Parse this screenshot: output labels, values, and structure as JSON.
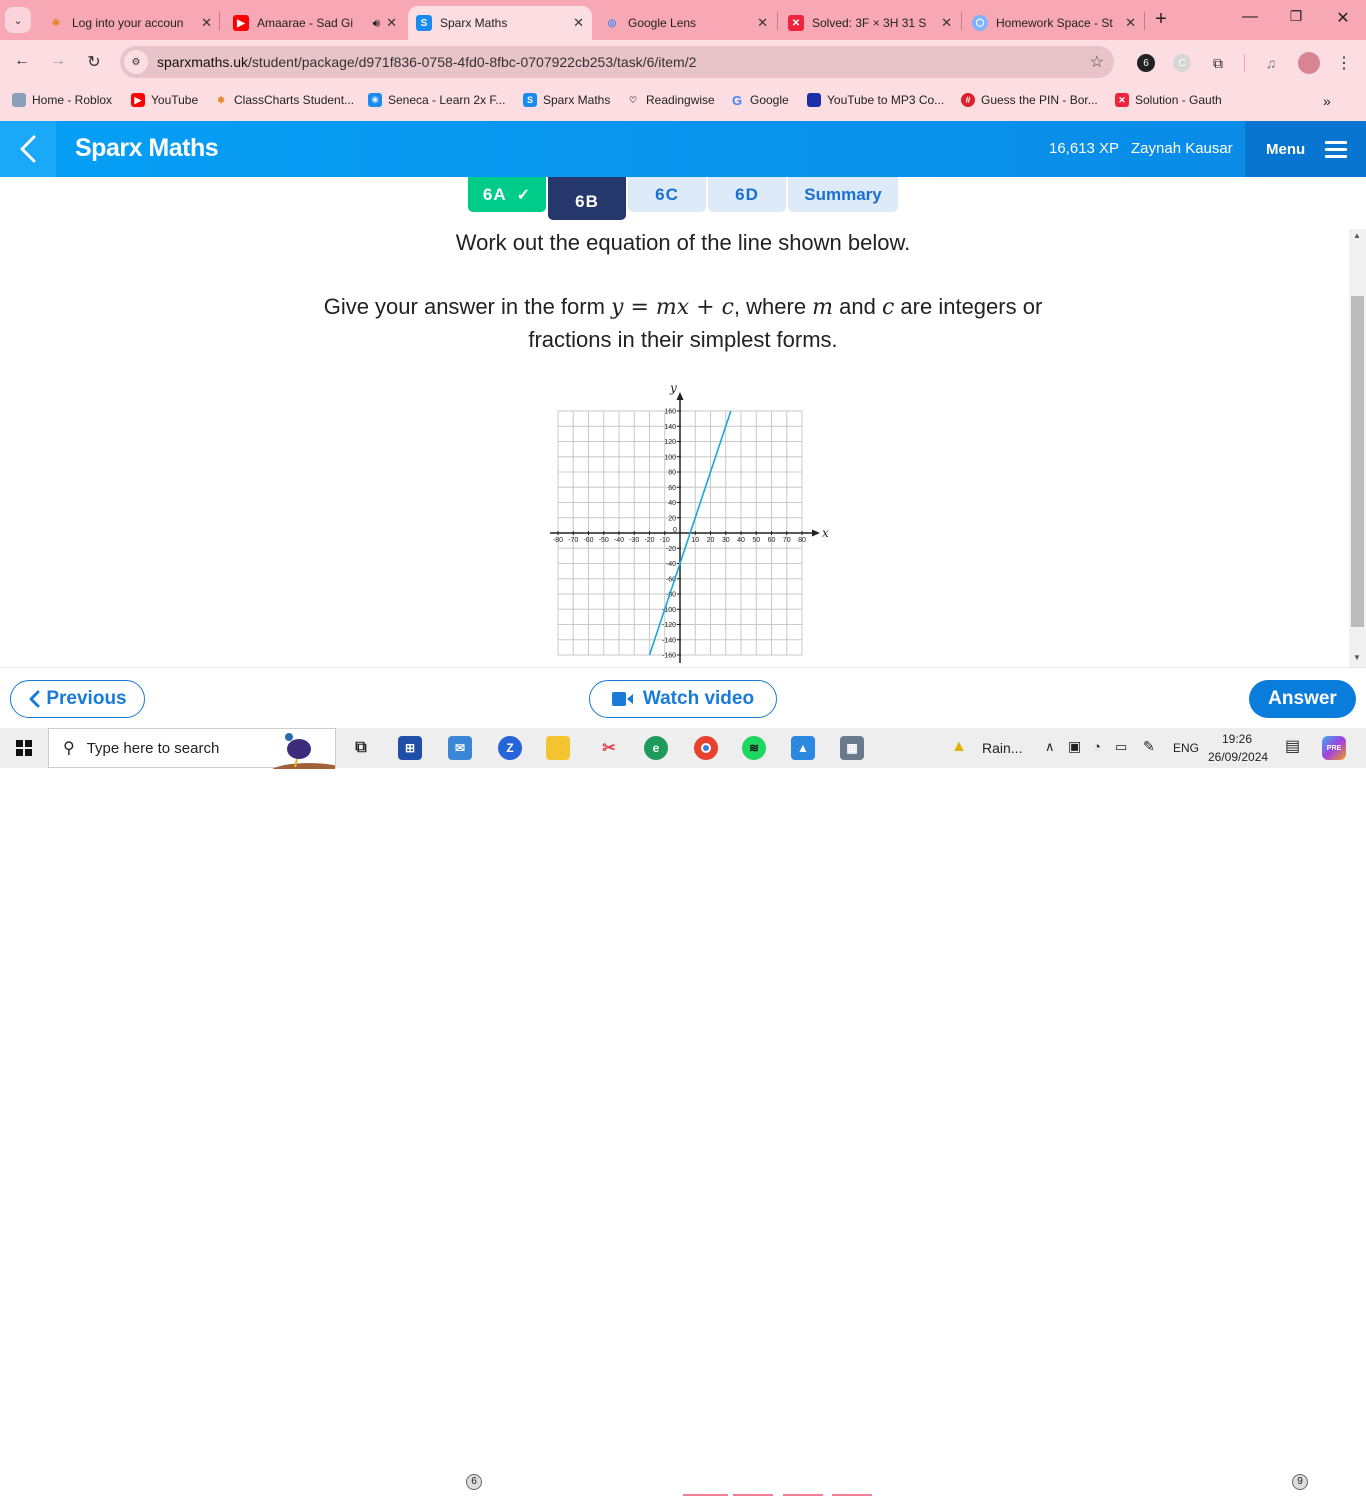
{
  "browser": {
    "tabs": [
      {
        "title": "Log into your accoun",
        "favicon": "classcharts-icon",
        "active": false,
        "audio": false
      },
      {
        "title": "Amaarae - Sad Gi",
        "favicon": "youtube-icon",
        "active": false,
        "audio": true
      },
      {
        "title": "Sparx Maths",
        "favicon": "sparx-icon",
        "active": true,
        "audio": false
      },
      {
        "title": "Google Lens",
        "favicon": "google-lens-icon",
        "active": false,
        "audio": false
      },
      {
        "title": "Solved: 3F × 3H 31 S",
        "favicon": "gauth-icon",
        "active": false,
        "audio": false
      },
      {
        "title": "Homework Space - St",
        "favicon": "homework-space-icon",
        "active": false,
        "audio": false
      }
    ],
    "new_tab": "+",
    "url_domain": "sparxmaths.uk",
    "url_path": "/student/package/d971f836-0758-4fd0-8fbc-0707922cb253/task/6/item/2",
    "bookmarks": [
      {
        "label": "Home - Roblox",
        "icon": "roblox-icon",
        "color": "#8aa0b8"
      },
      {
        "label": "YouTube",
        "icon": "youtube-icon",
        "color": "#ff0000"
      },
      {
        "label": "ClassCharts Student...",
        "icon": "classcharts-icon",
        "color": "#e58a2b"
      },
      {
        "label": "Seneca - Learn 2x F...",
        "icon": "seneca-icon",
        "color": "#1a8cf0"
      },
      {
        "label": "Sparx Maths",
        "icon": "sparx-icon",
        "color": "#1a8cf0"
      },
      {
        "label": "Readingwise",
        "icon": "readingwise-icon",
        "color": "#555555"
      },
      {
        "label": "Google",
        "icon": "google-icon",
        "color": "#4285f4"
      },
      {
        "label": "YouTube to MP3 Co...",
        "icon": "mp3-converter-icon",
        "color": "#1b2fa8"
      },
      {
        "label": "Guess the PIN - Bor...",
        "icon": "pin-game-icon",
        "color": "#e0202a"
      },
      {
        "label": "Solution - Gauth",
        "icon": "gauth-icon",
        "color": "#f0233c"
      }
    ],
    "more_bookmarks": "»"
  },
  "app": {
    "title": "Sparx Maths",
    "xp": "16,613 XP",
    "user": "Zaynah Kausar",
    "menu_label": "Menu",
    "brand_color": "#0a8ae6"
  },
  "task_tabs": [
    {
      "label": "6A",
      "state": "complete",
      "check": "✓",
      "bg": "#00cc8a",
      "fg": "#ffffff"
    },
    {
      "label": "6B",
      "state": "current",
      "bg": "#26386b",
      "fg": "#ffffff"
    },
    {
      "label": "6C",
      "state": "pending",
      "bg": "#ddeaf7",
      "fg": "#1a6fd0"
    },
    {
      "label": "6D",
      "state": "pending",
      "bg": "#ddeaf7",
      "fg": "#1a6fd0"
    },
    {
      "label": "Summary",
      "state": "pending",
      "bg": "#ddeaf7",
      "fg": "#1a6fd0"
    }
  ],
  "question": {
    "line1": "Work out the equation of the line shown below.",
    "line2_pre": "Give your answer in the form ",
    "line2_eq": "y = mx + c",
    "line2_mid1": ", where ",
    "line2_m": "m",
    "line2_mid2": " and ",
    "line2_c": "c",
    "line2_post": " are integers or",
    "line3": "fractions in their simplest forms."
  },
  "chart_data": {
    "type": "line",
    "title": "",
    "xlabel": "x",
    "ylabel": "y",
    "xlim": [
      -80,
      80
    ],
    "ylim": [
      -160,
      160
    ],
    "xticks": [
      -80,
      -70,
      -60,
      -50,
      -40,
      -30,
      -20,
      -10,
      10,
      20,
      30,
      40,
      50,
      60,
      70,
      80
    ],
    "yticks": [
      160,
      140,
      120,
      100,
      80,
      60,
      40,
      20,
      -20,
      -40,
      -60,
      -80,
      -100,
      -120,
      -140,
      -160
    ],
    "origin_label": "0",
    "grid": true,
    "series": [
      {
        "name": "line",
        "color": "#1aa7e0",
        "x": [
          -20,
          33.33
        ],
        "y": [
          -160,
          160
        ]
      }
    ]
  },
  "actions": {
    "previous": "Previous",
    "watch_video": "Watch video",
    "answer": "Answer"
  },
  "taskbar": {
    "search_placeholder": "Type here to search",
    "mail_badge": "6",
    "weather": "Rain...",
    "language": "ENG",
    "time": "19:26",
    "date": "26/09/2024",
    "notification_badge": "9"
  }
}
